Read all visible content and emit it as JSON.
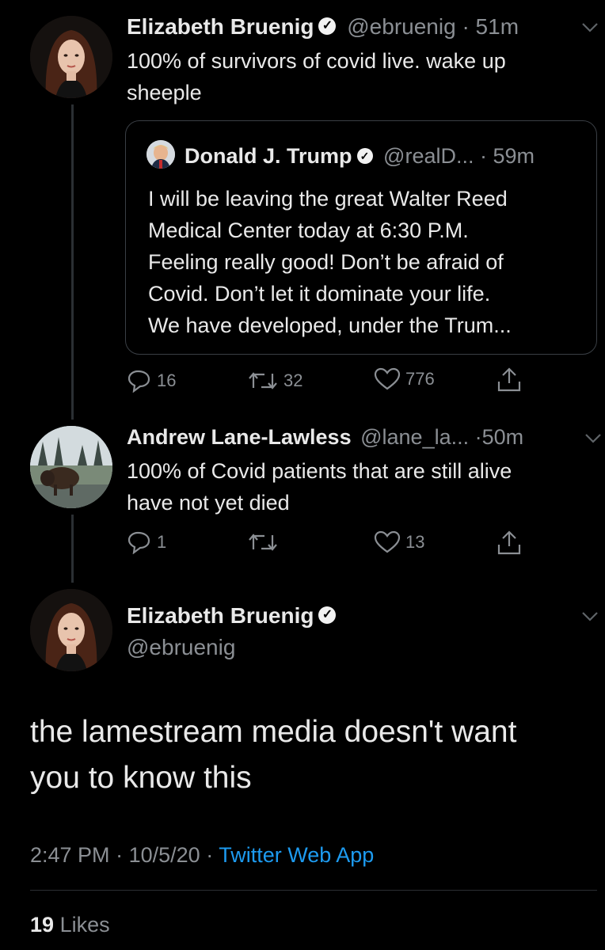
{
  "tweet1": {
    "display_name": "Elizabeth Bruenig",
    "handle": "@ebruenig",
    "time": "51m",
    "sep": "·",
    "text_line1": "100% of survivors of covid live. wake up",
    "text_line2": "sheeple",
    "actions": {
      "reply": "16",
      "retweet": "32",
      "like": "776"
    }
  },
  "quote": {
    "display_name": "Donald J. Trump",
    "handle": "@realD...",
    "time": "59m",
    "sep": "·",
    "lines": [
      "I will be leaving the great Walter Reed",
      "Medical Center today at 6:30 P.M.",
      "Feeling really good! Don’t be afraid of",
      "Covid. Don’t let it dominate your life.",
      "We have developed, under the Trum..."
    ]
  },
  "tweet2": {
    "display_name": "Andrew Lane-Lawless",
    "handle": "@lane_la...",
    "time": "50m",
    "sep": "·",
    "text_line1": "100% of Covid patients that are still alive",
    "text_line2": "have not yet died",
    "actions": {
      "reply": "1",
      "retweet": "",
      "like": "13"
    }
  },
  "main": {
    "display_name": "Elizabeth Bruenig",
    "handle": "@ebruenig",
    "text_line1": "the lamestream media doesn't want",
    "text_line2": "you to know this",
    "time": "2:47 PM",
    "date": "10/5/20",
    "sep": "·",
    "source": "Twitter Web App",
    "likes_count": "19",
    "likes_label": "Likes"
  },
  "colors": {
    "background": "#000000",
    "link": "#1d9bf0",
    "muted": "#8b8f94"
  }
}
